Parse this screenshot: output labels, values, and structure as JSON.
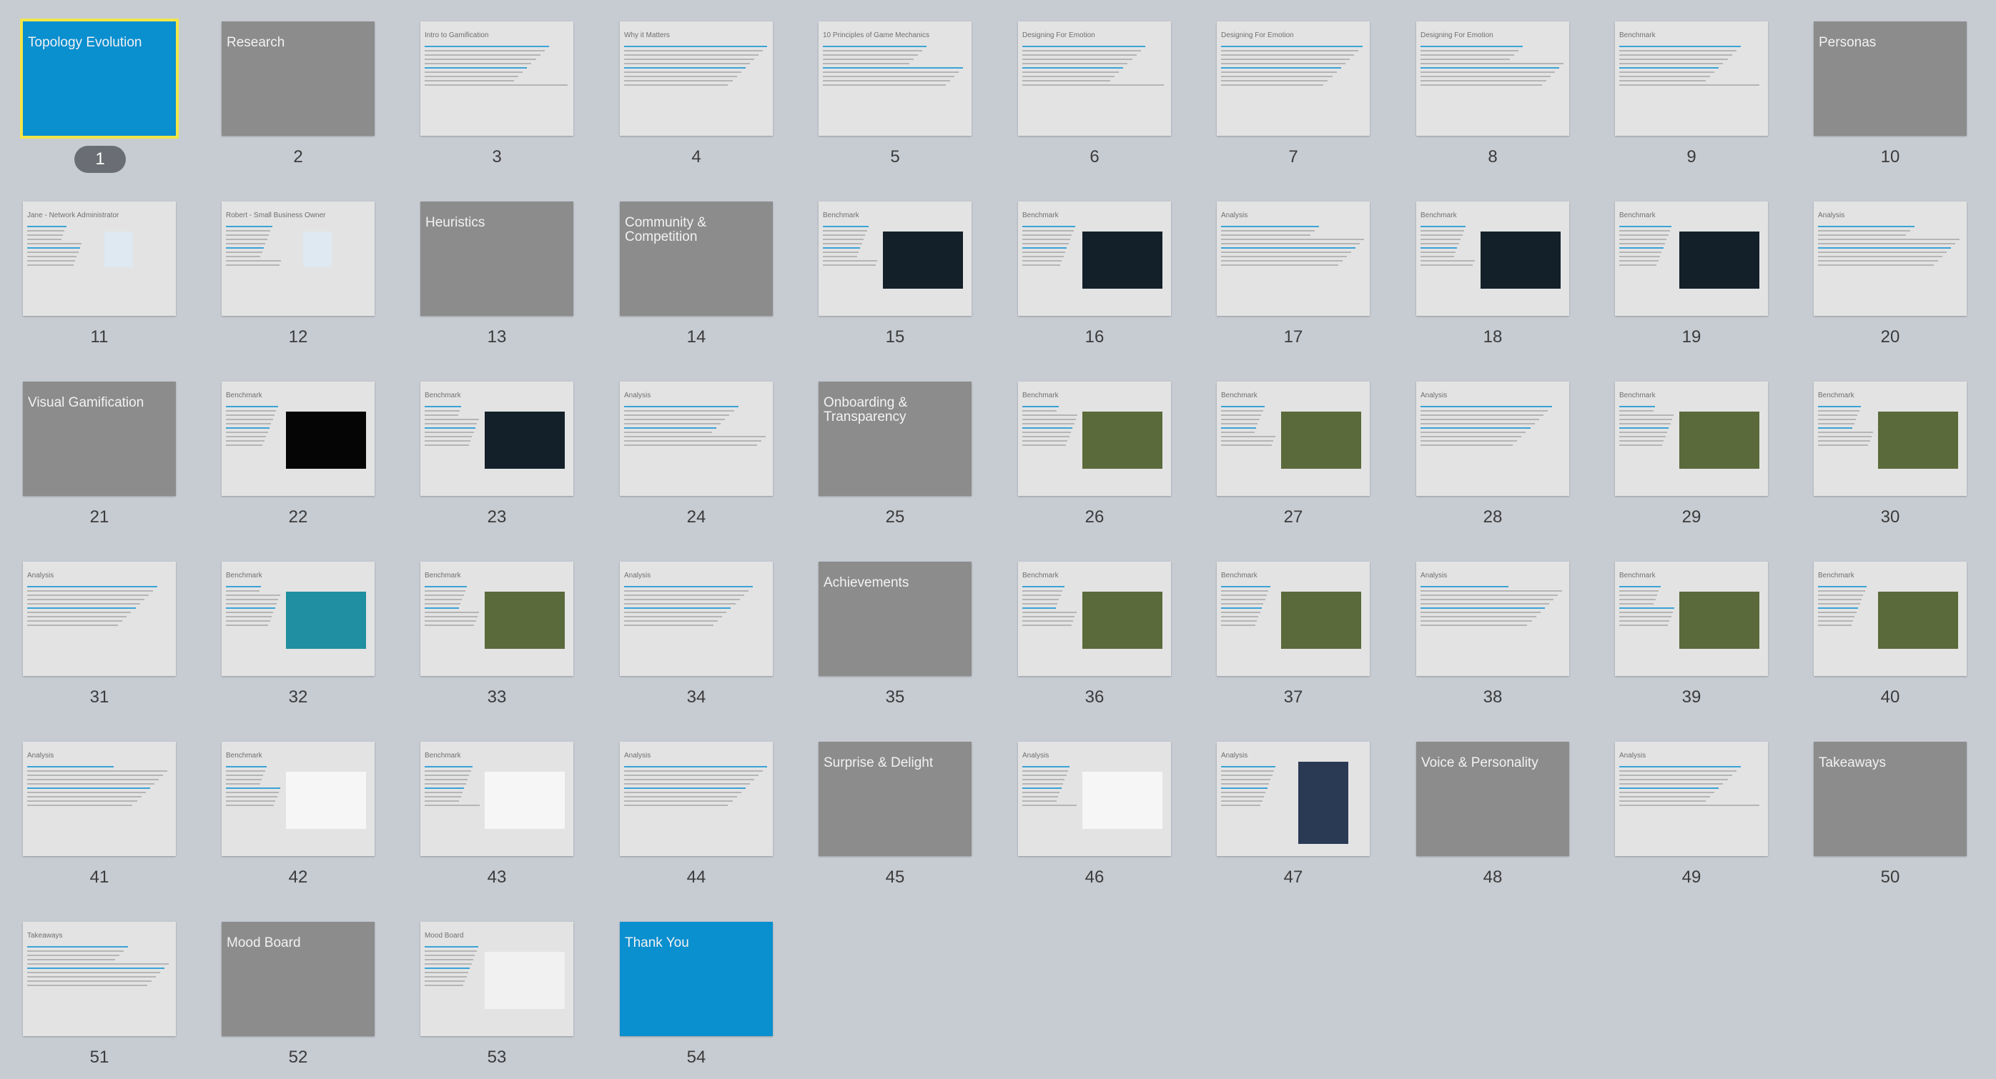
{
  "selected_slide": "1",
  "slides": [
    {
      "n": "1",
      "type": "title",
      "label": "Topology Evolution"
    },
    {
      "n": "2",
      "type": "section",
      "label": "Research"
    },
    {
      "n": "3",
      "type": "content",
      "heading": "Intro to Gamification",
      "image": "none"
    },
    {
      "n": "4",
      "type": "content",
      "heading": "Why it Matters",
      "image": "none"
    },
    {
      "n": "5",
      "type": "content",
      "heading": "10 Principles of Game Mechanics",
      "image": "none"
    },
    {
      "n": "6",
      "type": "content",
      "heading": "Designing For Emotion",
      "image": "none"
    },
    {
      "n": "7",
      "type": "content",
      "heading": "Designing For Emotion",
      "image": "none"
    },
    {
      "n": "8",
      "type": "content",
      "heading": "Designing For Emotion",
      "image": "none"
    },
    {
      "n": "9",
      "type": "content",
      "heading": "Benchmark",
      "image": "none"
    },
    {
      "n": "10",
      "type": "section",
      "label": "Personas"
    },
    {
      "n": "11",
      "type": "content",
      "heading": "Jane - Network Administrator",
      "image": "photo"
    },
    {
      "n": "12",
      "type": "content",
      "heading": "Robert - Small Business Owner",
      "image": "photo"
    },
    {
      "n": "13",
      "type": "section",
      "label": "Heuristics"
    },
    {
      "n": "14",
      "type": "section",
      "label": "Community & Competition"
    },
    {
      "n": "15",
      "type": "content",
      "heading": "Benchmark",
      "image": "dark"
    },
    {
      "n": "16",
      "type": "content",
      "heading": "Benchmark",
      "image": "dark"
    },
    {
      "n": "17",
      "type": "content",
      "heading": "Analysis",
      "image": "none"
    },
    {
      "n": "18",
      "type": "content",
      "heading": "Benchmark",
      "image": "dark"
    },
    {
      "n": "19",
      "type": "content",
      "heading": "Benchmark",
      "image": "dark"
    },
    {
      "n": "20",
      "type": "content",
      "heading": "Analysis",
      "image": "none"
    },
    {
      "n": "21",
      "type": "section",
      "label": "Visual Gamification"
    },
    {
      "n": "22",
      "type": "content",
      "heading": "Benchmark",
      "image": "black"
    },
    {
      "n": "23",
      "type": "content",
      "heading": "Benchmark",
      "image": "dark"
    },
    {
      "n": "24",
      "type": "content",
      "heading": "Analysis",
      "image": "none"
    },
    {
      "n": "25",
      "type": "section",
      "label": "Onboarding & Transparency"
    },
    {
      "n": "26",
      "type": "content",
      "heading": "Benchmark",
      "image": "game"
    },
    {
      "n": "27",
      "type": "content",
      "heading": "Benchmark",
      "image": "game"
    },
    {
      "n": "28",
      "type": "content",
      "heading": "Analysis",
      "image": "none"
    },
    {
      "n": "29",
      "type": "content",
      "heading": "Benchmark",
      "image": "game"
    },
    {
      "n": "30",
      "type": "content",
      "heading": "Benchmark",
      "image": "game"
    },
    {
      "n": "31",
      "type": "content",
      "heading": "Analysis",
      "image": "none"
    },
    {
      "n": "32",
      "type": "content",
      "heading": "Benchmark",
      "image": "teal"
    },
    {
      "n": "33",
      "type": "content",
      "heading": "Benchmark",
      "image": "game"
    },
    {
      "n": "34",
      "type": "content",
      "heading": "Analysis",
      "image": "none"
    },
    {
      "n": "35",
      "type": "section",
      "label": "Achievements"
    },
    {
      "n": "36",
      "type": "content",
      "heading": "Benchmark",
      "image": "game"
    },
    {
      "n": "37",
      "type": "content",
      "heading": "Benchmark",
      "image": "game"
    },
    {
      "n": "38",
      "type": "content",
      "heading": "Analysis",
      "image": "none"
    },
    {
      "n": "39",
      "type": "content",
      "heading": "Benchmark",
      "image": "game"
    },
    {
      "n": "40",
      "type": "content",
      "heading": "Benchmark",
      "image": "game"
    },
    {
      "n": "41",
      "type": "content",
      "heading": "Analysis",
      "image": "none"
    },
    {
      "n": "42",
      "type": "content",
      "heading": "Benchmark",
      "image": "light"
    },
    {
      "n": "43",
      "type": "content",
      "heading": "Benchmark",
      "image": "light"
    },
    {
      "n": "44",
      "type": "content",
      "heading": "Analysis",
      "image": "none"
    },
    {
      "n": "45",
      "type": "section",
      "label": "Surprise & Delight"
    },
    {
      "n": "46",
      "type": "content",
      "heading": "Analysis",
      "image": "light"
    },
    {
      "n": "47",
      "type": "content",
      "heading": "Analysis",
      "image": "poster"
    },
    {
      "n": "48",
      "type": "section",
      "label": "Voice & Personality"
    },
    {
      "n": "49",
      "type": "content",
      "heading": "Analysis",
      "image": "none"
    },
    {
      "n": "50",
      "type": "section",
      "label": "Takeaways"
    },
    {
      "n": "51",
      "type": "content",
      "heading": "Takeaways",
      "image": "none"
    },
    {
      "n": "52",
      "type": "section",
      "label": "Mood Board"
    },
    {
      "n": "53",
      "type": "content",
      "heading": "Mood Board",
      "image": "collage"
    },
    {
      "n": "54",
      "type": "title",
      "label": "Thank You"
    }
  ],
  "colors": {
    "background": "#c7cbd2",
    "section_slide": "#8c8c8c",
    "title_slide": "#0a8fcf",
    "content_slide": "#e3e3e3",
    "selection_outline": "#f2e64a",
    "selected_badge": "#6a6d73"
  }
}
